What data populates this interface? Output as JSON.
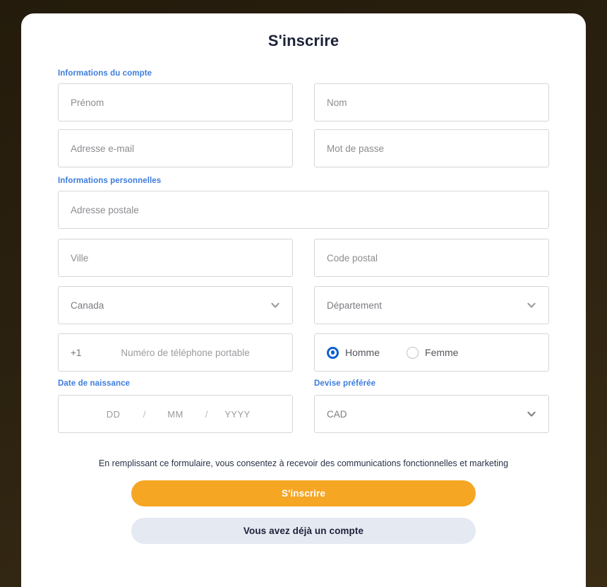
{
  "page": {
    "title": "S'inscrire",
    "background_color": "#241b0c",
    "card_background": "#ffffff"
  },
  "colors": {
    "section_label": "#3d7ddd",
    "primary_button": "#f5a623",
    "secondary_button": "#e4e9f2",
    "radio_selected": "#0b5fd1",
    "title_text": "#1b2238",
    "field_border": "#d6d6d6",
    "placeholder": "#8d8d92"
  },
  "sections": {
    "account": {
      "label": "Informations du compte",
      "fields": {
        "first_name": {
          "placeholder": "Prénom",
          "value": ""
        },
        "last_name": {
          "placeholder": "Nom",
          "value": ""
        },
        "email": {
          "placeholder": "Adresse e-mail",
          "value": ""
        },
        "password": {
          "placeholder": "Mot de passe",
          "value": ""
        }
      }
    },
    "personal": {
      "label": "Informations personnelles",
      "fields": {
        "street_address": {
          "placeholder": "Adresse postale",
          "value": ""
        },
        "city": {
          "placeholder": "Ville",
          "value": ""
        },
        "postal_code": {
          "placeholder": "Code postal",
          "value": ""
        },
        "country": {
          "value": "Canada",
          "icon": "chevron-down-icon"
        },
        "province": {
          "value": "Département",
          "icon": "chevron-down-icon"
        },
        "phone": {
          "prefix": "+1",
          "placeholder": "Numéro de téléphone portable",
          "value": ""
        },
        "gender": {
          "options": [
            {
              "label": "Homme",
              "selected": true
            },
            {
              "label": "Femme",
              "selected": false
            }
          ]
        }
      }
    },
    "birth": {
      "label": "Date de naissance",
      "day_placeholder": "DD",
      "month_placeholder": "MM",
      "year_placeholder": "YYYY",
      "separator": "/"
    },
    "currency": {
      "label": "Devise préférée",
      "value": "CAD",
      "icon": "chevron-down-icon"
    }
  },
  "footer": {
    "consent": "En remplissant ce formulaire, vous consentez à recevoir des communications fonctionnelles et marketing",
    "submit_label": "S'inscrire",
    "existing_account_label": "Vous avez déjà un compte"
  }
}
